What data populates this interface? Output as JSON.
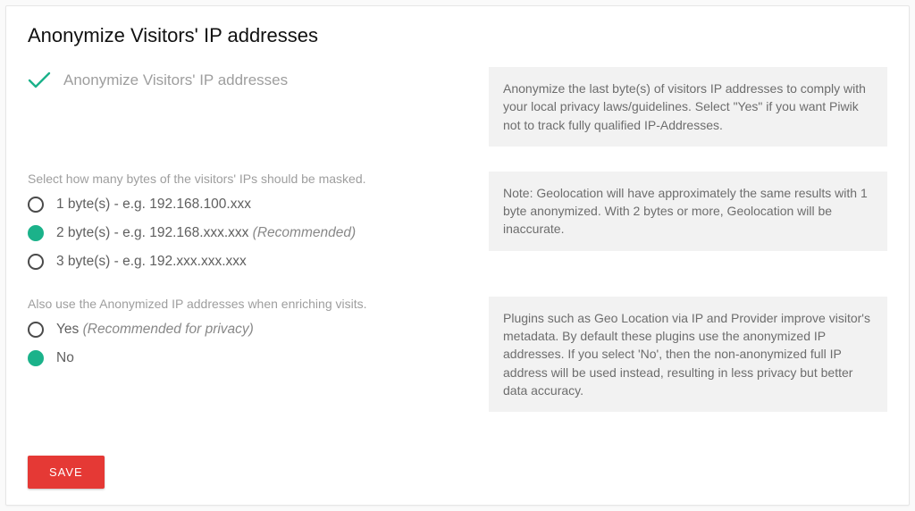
{
  "title": "Anonymize Visitors' IP addresses",
  "section1": {
    "label": "Anonymize Visitors' IP addresses",
    "help": "Anonymize the last byte(s) of visitors IP addresses to comply with your local privacy laws/guidelines. Select \"Yes\" if you want Piwik not to track fully qualified IP-Addresses."
  },
  "section2": {
    "label": "Select how many bytes of the visitors' IPs should be masked.",
    "options": [
      {
        "text": "1 byte(s) - e.g. 192.168.100.xxx",
        "hint": "",
        "selected": false
      },
      {
        "text": "2 byte(s) - e.g. 192.168.xxx.xxx",
        "hint": " (Recommended)",
        "selected": true
      },
      {
        "text": "3 byte(s) - e.g. 192.xxx.xxx.xxx",
        "hint": "",
        "selected": false
      }
    ],
    "help": "Note: Geolocation will have approximately the same results with 1 byte anonymized. With 2 bytes or more, Geolocation will be inaccurate."
  },
  "section3": {
    "label": "Also use the Anonymized IP addresses when enriching visits.",
    "options": [
      {
        "text": "Yes",
        "hint": " (Recommended for privacy)",
        "selected": false
      },
      {
        "text": "No",
        "hint": "",
        "selected": true
      }
    ],
    "help": "Plugins such as Geo Location via IP and Provider improve visitor's metadata. By default these plugins use the anonymized IP addresses. If you select 'No', then the non-anonymized full IP address will be used instead, resulting in less privacy but better data accuracy."
  },
  "save": "SAVE"
}
